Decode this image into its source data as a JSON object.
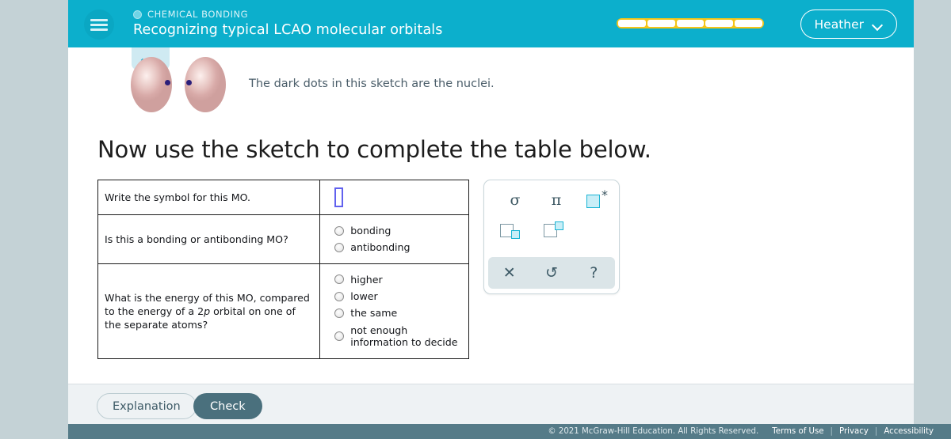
{
  "header": {
    "menu_icon": "hamburger-icon",
    "eyebrow": "CHEMICAL BONDING",
    "title": "Recognizing typical LCAO molecular orbitals",
    "progress_segments": 5,
    "progress_color": "#f5c518",
    "user_name": "Heather",
    "user_chevron_icon": "chevron-down-icon",
    "background_color": "#0cafcc"
  },
  "sketch": {
    "tab_icon": "chevron-down-icon",
    "note": "The dark dots in this sketch are the nuclei.",
    "lobe_color": "#e6c3c0",
    "nucleus_color": "#2b1e7a"
  },
  "main": {
    "heading": "Now use the sketch to complete the table below."
  },
  "table": {
    "rows": [
      {
        "question": "Write the symbol for this MO.",
        "answer_type": "input",
        "input_value": "",
        "options": []
      },
      {
        "question": "Is this a bonding or antibonding MO?",
        "answer_type": "radio",
        "options": [
          "bonding",
          "antibonding"
        ]
      },
      {
        "question_parts": {
          "before": "What is the energy of this MO, compared to the energy of a 2",
          "italic": "p",
          "after": " orbital on one of the separate atoms?"
        },
        "answer_type": "radio",
        "options": [
          "higher",
          "lower",
          "the same",
          "not enough information to decide"
        ]
      }
    ]
  },
  "palette": {
    "symbols": [
      {
        "name": "sigma-symbol",
        "glyph": "σ"
      },
      {
        "name": "pi-symbol",
        "glyph": "π"
      },
      {
        "name": "antibonding-star-symbol",
        "glyph": "□*"
      },
      {
        "name": "subscript-box-symbol",
        "glyph": "□▫"
      },
      {
        "name": "superscript-box-symbol",
        "glyph": "□▫"
      }
    ],
    "actions": [
      {
        "name": "clear-button",
        "glyph": "✕"
      },
      {
        "name": "undo-button",
        "glyph": "↺"
      },
      {
        "name": "help-button",
        "glyph": "?"
      }
    ],
    "accent_color": "#19b4d4",
    "box_border_color": "#7d98a3"
  },
  "actions": {
    "explanation_label": "Explanation",
    "check_label": "Check",
    "check_bg": "#4a707d"
  },
  "footer": {
    "copyright": "© 2021 McGraw-Hill Education. All Rights Reserved.",
    "links": [
      "Terms of Use",
      "Privacy",
      "Accessibility"
    ],
    "separator": "|",
    "background_color": "#557b88"
  }
}
